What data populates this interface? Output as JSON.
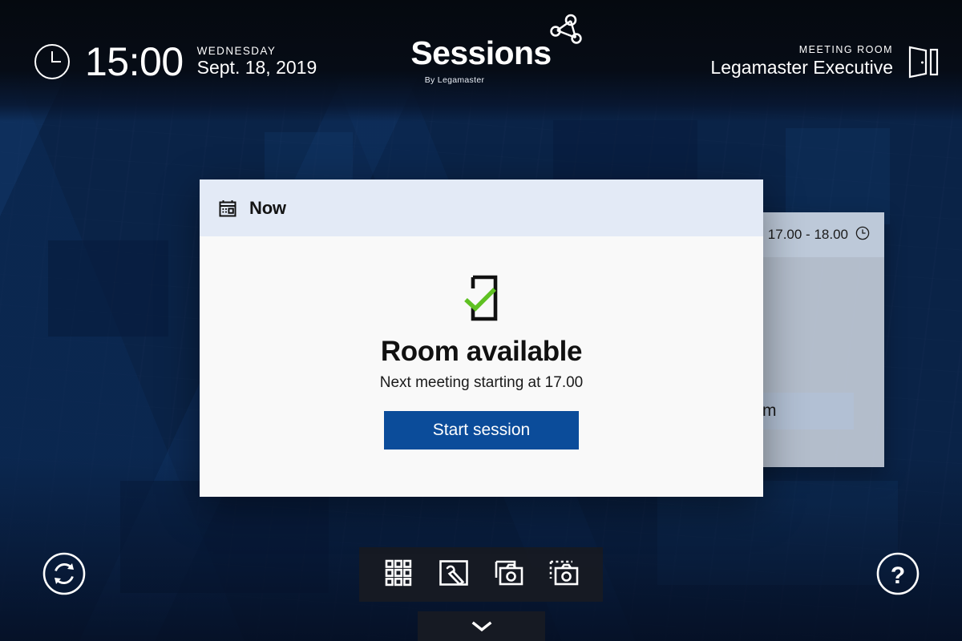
{
  "header": {
    "clock_icon": "clock-icon",
    "time": "15:00",
    "day_of_week": "WEDNESDAY",
    "date": "Sept. 18, 2019",
    "logo_word": "Sessions",
    "logo_sub": "By Legamaster",
    "logo_mark_icon": "network-nodes-icon",
    "room_label": "MEETING ROOM",
    "room_name": "Legamaster Executive",
    "door_icon": "open-door-icon"
  },
  "behind_card": {
    "time_range": "17.00 - 18.00",
    "clock_icon": "clock-icon",
    "book_button": "Book room"
  },
  "modal": {
    "head_icon": "calendar-icon",
    "head_title": "Now",
    "status_icon": "door-check-icon",
    "status_title": "Room available",
    "status_subtitle": "Next meeting starting at 17.00",
    "cta_label": "Start session"
  },
  "bottom": {
    "refresh_icon": "refresh-sync-icon",
    "help_icon": "question-mark-icon",
    "dock_items": [
      {
        "icon": "apps-grid-icon",
        "label": "Apps"
      },
      {
        "icon": "whiteboard-pen-icon",
        "label": "Whiteboard"
      },
      {
        "icon": "screenshot-camera-icon",
        "label": "Screenshot"
      },
      {
        "icon": "region-capture-camera-icon",
        "label": "Region capture"
      }
    ],
    "drawer_chevron_icon": "chevron-down-icon"
  },
  "colors": {
    "accent_blue": "#0b4c9a",
    "check_green": "#5fc122",
    "modal_head": "#e3eaf6",
    "modal_body": "#f9f9f9",
    "background_deep_blue": "#0b2347",
    "dock_dark": "#171b23"
  }
}
